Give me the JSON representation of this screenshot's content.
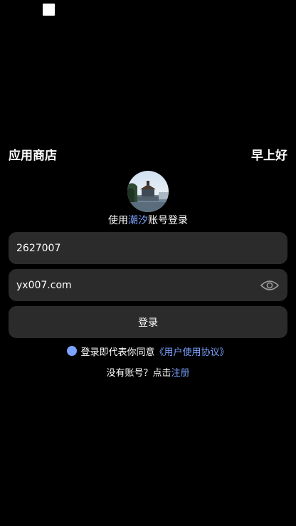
{
  "header": {
    "title": "应用商店",
    "greeting": "早上好"
  },
  "login": {
    "caption_prefix": "使用",
    "caption_brand": "潮汐",
    "caption_suffix": "账号登录"
  },
  "form": {
    "account_value": "2627007",
    "password_value": "yx007.com",
    "submit_label": "登录"
  },
  "agreement": {
    "text": "登录即代表你同意",
    "link": "《用户使用协议》"
  },
  "register": {
    "prompt": "没有账号？点击",
    "link": "注册"
  },
  "icons": {
    "status": "square-icon",
    "visibility": "eye-icon",
    "agree": "radio-dot-icon"
  },
  "colors": {
    "background": "#000000",
    "field": "#2b2b2b",
    "accent": "#7aa2ff",
    "text": "#ffffff"
  }
}
